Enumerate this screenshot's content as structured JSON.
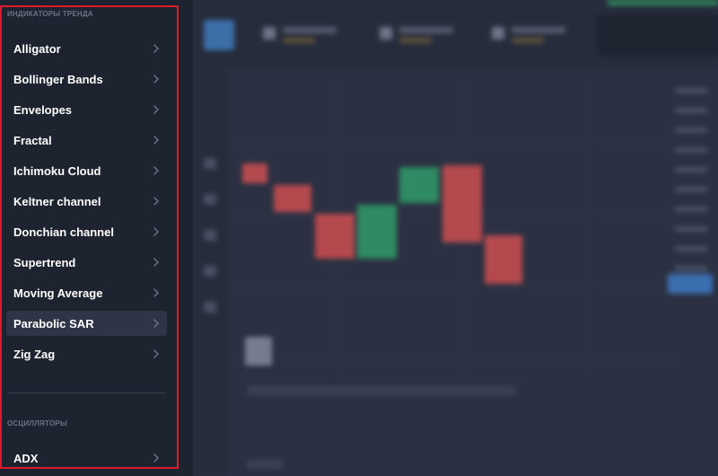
{
  "panel": {
    "trend_section_title": "ИНДИКАТОРЫ ТРЕНДА",
    "oscillators_section_title": "ОСЦИЛЛЯТОРЫ",
    "trend_items": [
      {
        "label": "Alligator"
      },
      {
        "label": "Bollinger Bands"
      },
      {
        "label": "Envelopes"
      },
      {
        "label": "Fractal"
      },
      {
        "label": "Ichimoku Cloud"
      },
      {
        "label": "Keltner channel"
      },
      {
        "label": "Donchian channel"
      },
      {
        "label": "Supertrend"
      },
      {
        "label": "Moving Average"
      },
      {
        "label": "Parabolic SAR",
        "active": true
      },
      {
        "label": "Zig Zag"
      }
    ],
    "oscillator_items": [
      {
        "label": "ADX"
      }
    ]
  },
  "colors": {
    "panel_bg": "#1e2330",
    "highlight_border": "#e0192b",
    "candle_up": "#2f8b63",
    "candle_down": "#b54a4e",
    "accent_blue": "#3b6fb0"
  },
  "icons": {
    "item_chevron": "chevron-right-icon"
  }
}
